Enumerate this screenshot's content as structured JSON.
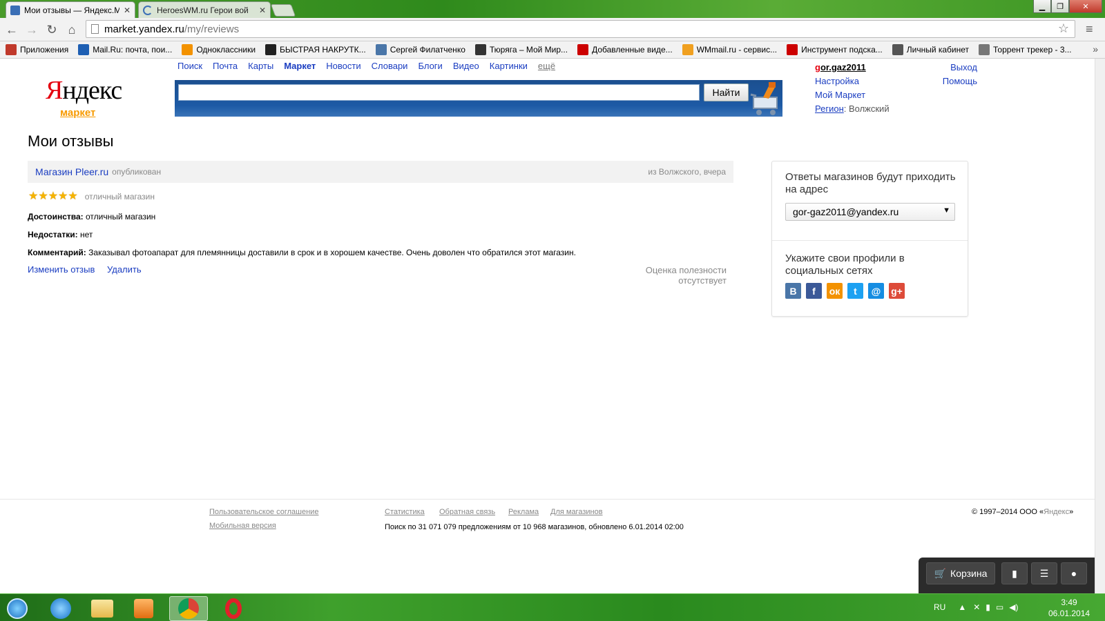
{
  "browser": {
    "tabs": [
      {
        "title": "Мои отзывы — Яндекс.М",
        "active": true
      },
      {
        "title": "HeroesWM.ru Герои вой",
        "active": false
      }
    ],
    "url_host": "market.yandex.ru",
    "url_path": "/my/reviews",
    "bookmarks": [
      {
        "label": "Приложения",
        "icon": "apps-icon",
        "color": "#c0392b"
      },
      {
        "label": "Mail.Ru: почта, пои...",
        "icon": "mailru-icon",
        "color": "#1e5fb3"
      },
      {
        "label": "Одноклассники",
        "icon": "odnoklassniki-icon",
        "color": "#f39200"
      },
      {
        "label": "БЫСТРАЯ НАКРУТК...",
        "icon": "heart-icon",
        "color": "#222222"
      },
      {
        "label": "Сергей Филатченко",
        "icon": "vk-icon",
        "color": "#4a76a8"
      },
      {
        "label": "Тюряга – Мой Мир...",
        "icon": "hash-icon",
        "color": "#333333"
      },
      {
        "label": "Добавленные виде...",
        "icon": "youtube-icon",
        "color": "#cc0000"
      },
      {
        "label": "WMmail.ru - сервис...",
        "icon": "wmmail-icon",
        "color": "#f0a020"
      },
      {
        "label": "Инструмент подска...",
        "icon": "youtube-icon",
        "color": "#cc0000"
      },
      {
        "label": "Личный кабинет",
        "icon": "gift-icon",
        "color": "#555555"
      },
      {
        "label": "Торрент трекер - 3...",
        "icon": "torrent-icon",
        "color": "#777777"
      }
    ]
  },
  "header": {
    "logo_first": "Я",
    "logo_rest": "ндекс",
    "logo_sub": "маркет",
    "services": [
      {
        "label": "Поиск"
      },
      {
        "label": "Почта"
      },
      {
        "label": "Карты"
      },
      {
        "label": "Маркет",
        "active": true
      },
      {
        "label": "Новости"
      },
      {
        "label": "Словари"
      },
      {
        "label": "Блоги"
      },
      {
        "label": "Видео"
      },
      {
        "label": "Картинки"
      }
    ],
    "more": "ещё",
    "search_value": "",
    "search_button": "Найти"
  },
  "user": {
    "name_first": "g",
    "name_rest": "or.gaz2011",
    "settings": "Настройка",
    "my_market": "Мой Маркет",
    "region_label": "Регион",
    "region_value": ": Волжский",
    "logout": "Выход",
    "help": "Помощь"
  },
  "page": {
    "title": "Мои отзывы"
  },
  "review": {
    "shop": "Магазин Pleer.ru",
    "status": "опубликован",
    "meta": "из Волжского, вчера",
    "stars": 5,
    "rating_text": "отличный магазин",
    "pros_label": "Достоинства:",
    "pros": " отличный магазин",
    "cons_label": "Недостатки:",
    "cons": " нет",
    "comment_label": "Комментарий:",
    "comment": " Заказывал фотоапарат для племянницы доставили в срок и в хорошем качестве. Очень доволен что обратился этот магазин.",
    "edit": "Изменить отзыв",
    "delete": "Удалить",
    "usefulness": "Оценка полезности отсутствует"
  },
  "sidebar": {
    "answers_text": "Ответы магазинов будут приходить на адрес",
    "email": "gor-gaz2011@yandex.ru",
    "social_text": "Укажите свои профили в социальных сетях",
    "socials": [
      {
        "name": "vk-icon",
        "glyph": "В",
        "color": "#4a76a8"
      },
      {
        "name": "facebook-icon",
        "glyph": "f",
        "color": "#3b5998"
      },
      {
        "name": "odnoklassniki-icon",
        "glyph": "ок",
        "color": "#f39200"
      },
      {
        "name": "twitter-icon",
        "glyph": "t",
        "color": "#1da1f2"
      },
      {
        "name": "mailru-icon",
        "glyph": "@",
        "color": "#168de2"
      },
      {
        "name": "google-plus-icon",
        "glyph": "g+",
        "color": "#dd4b39"
      }
    ]
  },
  "footer": {
    "agreement": "Пользовательское соглашение",
    "mobile": "Мобильная версия",
    "links": [
      "Статистика",
      "Обратная связь",
      "Реклама",
      "Для магазинов"
    ],
    "stats": "Поиск по 31 071 079 предложениям от 10 968 магазинов, обновлено 6.01.2014 02:00",
    "copyright_prefix": "© 1997–2014  ООО «",
    "copyright_link": "Яндекс",
    "copyright_suffix": "»"
  },
  "widget": {
    "cart": "Корзина"
  },
  "taskbar": {
    "lang": "RU",
    "time": "3:49",
    "date": "06.01.2014"
  }
}
